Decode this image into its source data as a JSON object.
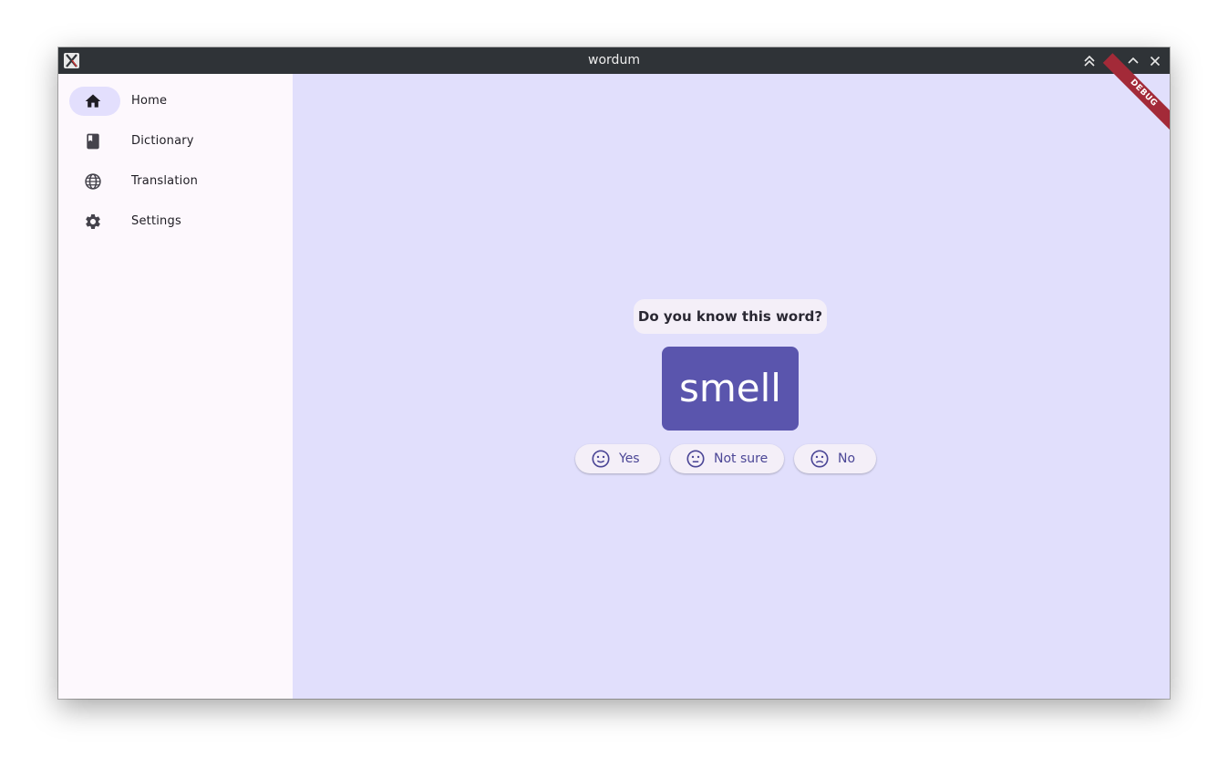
{
  "window": {
    "title": "wordum",
    "controls": [
      "keep-above-icon",
      "minimize-icon",
      "maximize-icon",
      "close-icon"
    ]
  },
  "sidebar": {
    "items": [
      {
        "label": "Home",
        "icon": "home-icon",
        "active": true
      },
      {
        "label": "Dictionary",
        "icon": "book-icon",
        "active": false
      },
      {
        "label": "Translation",
        "icon": "globe-icon",
        "active": false
      },
      {
        "label": "Settings",
        "icon": "gear-icon",
        "active": false
      }
    ]
  },
  "main": {
    "question": "Do you know this word?",
    "word": "smell",
    "answers": [
      {
        "label": "Yes",
        "icon": "smile-face-icon"
      },
      {
        "label": "Not sure",
        "icon": "neutral-face-icon"
      },
      {
        "label": "No",
        "icon": "sad-face-icon"
      }
    ]
  },
  "debug_banner": "DEBUG",
  "colors": {
    "titlebar": "#2f3337",
    "sidebar_bg": "#fdf8fd",
    "main_bg": "#e1dffc",
    "accent": "#5a55ad",
    "active_pill": "#e3dffd",
    "debug_banner": "#a32a38"
  }
}
